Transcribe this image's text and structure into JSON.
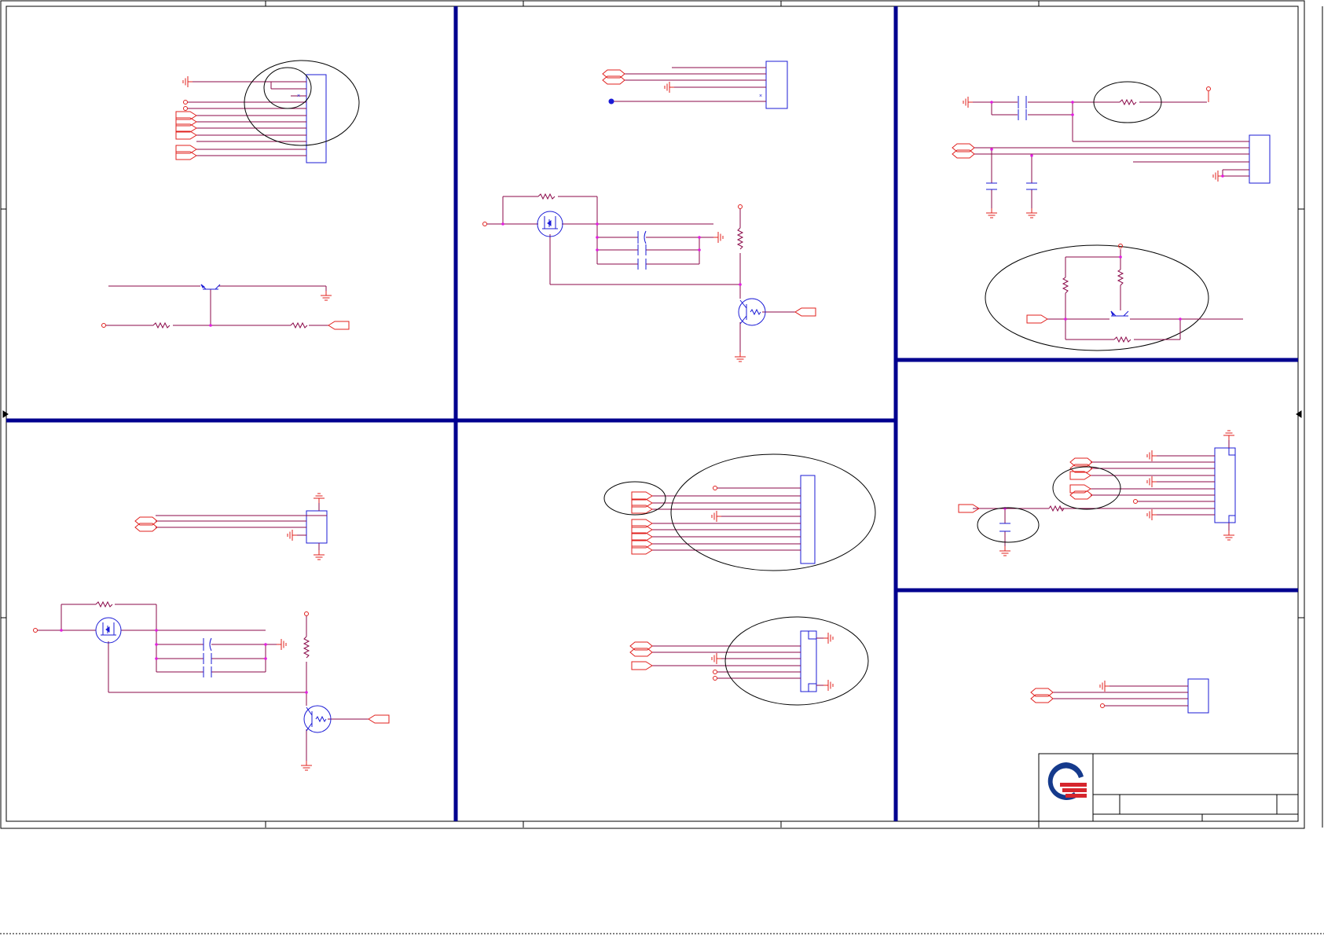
{
  "sheet": {
    "colors": {
      "wire": "#8b0a4a",
      "net_port": "#e0201e",
      "ground": "#e0201e",
      "component": "#1b1bd6",
      "junction": "#e21ee0",
      "section_border": "#00008f",
      "frame": "#000000",
      "highlight_ellipse": "#000000",
      "logo_blue": "#153a8c",
      "logo_red": "#d6252d"
    },
    "icons": {
      "ground": "ground-icon",
      "chassis_ground": "chassis-ground-icon",
      "net_port": "net-port-icon",
      "connector": "connector-icon",
      "resistor": "resistor-icon",
      "capacitor": "capacitor-icon",
      "mosfet": "mosfet-icon",
      "transistor": "transistor-icon",
      "company_logo": "company-logo-icon"
    },
    "title_block": {
      "title": "",
      "document_number": "",
      "revision": "",
      "date": "",
      "sheet_of": ""
    }
  }
}
